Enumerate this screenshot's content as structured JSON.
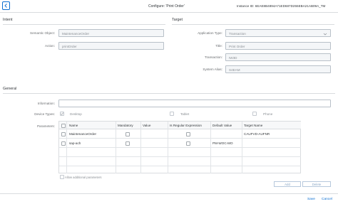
{
  "header": {
    "title": "Configure: 'Print Order'",
    "instance_id": "Instance ID: 6EAE8B4894A71ED687D255EBA21AB09A_TM"
  },
  "intent": {
    "heading": "Intent",
    "semantic_object_label": "Semantic Object:",
    "semantic_object_value": "MaintenanceOrder",
    "action_label": "Action:",
    "action_value": "printOrder"
  },
  "target": {
    "heading": "Target",
    "app_type_label": "Application Type:",
    "app_type_value": "Transaction",
    "title_label": "Title:",
    "title_value": "Print Order",
    "transaction_label": "Transaction:",
    "transaction_value": "IW3D",
    "system_alias_label": "System Alias:",
    "system_alias_value": "S4EAM"
  },
  "general": {
    "heading": "General",
    "information_label": "Information:",
    "information_value": "",
    "device_types_label": "Device Types:",
    "devices": [
      {
        "label": "Desktop",
        "checked": true
      },
      {
        "label": "Tablet",
        "checked": false
      },
      {
        "label": "Phone",
        "checked": false
      }
    ],
    "parameters_label": "Parameters:"
  },
  "params_table": {
    "headers": [
      "Name",
      "Mandatory",
      "Value",
      "Is Regular Expression",
      "Default Value",
      "Target Name"
    ],
    "rows": [
      {
        "name": "MaintenanceOrder",
        "value": "",
        "default": "",
        "target": "CAUFVD-AUFNR"
      },
      {
        "name": "sap-ach",
        "value": "",
        "default": "PM-WOC-MO",
        "target": ""
      }
    ],
    "allow_additional": "Allow additional parameters",
    "add_label": "Add",
    "delete_label": "Delete"
  },
  "footer": {
    "save_label": "Save",
    "cancel_label": "Cancel"
  },
  "colors": {
    "accent": "#0a6ed1",
    "field_bg": "#f4f6f8",
    "border": "#b8c0c8"
  }
}
